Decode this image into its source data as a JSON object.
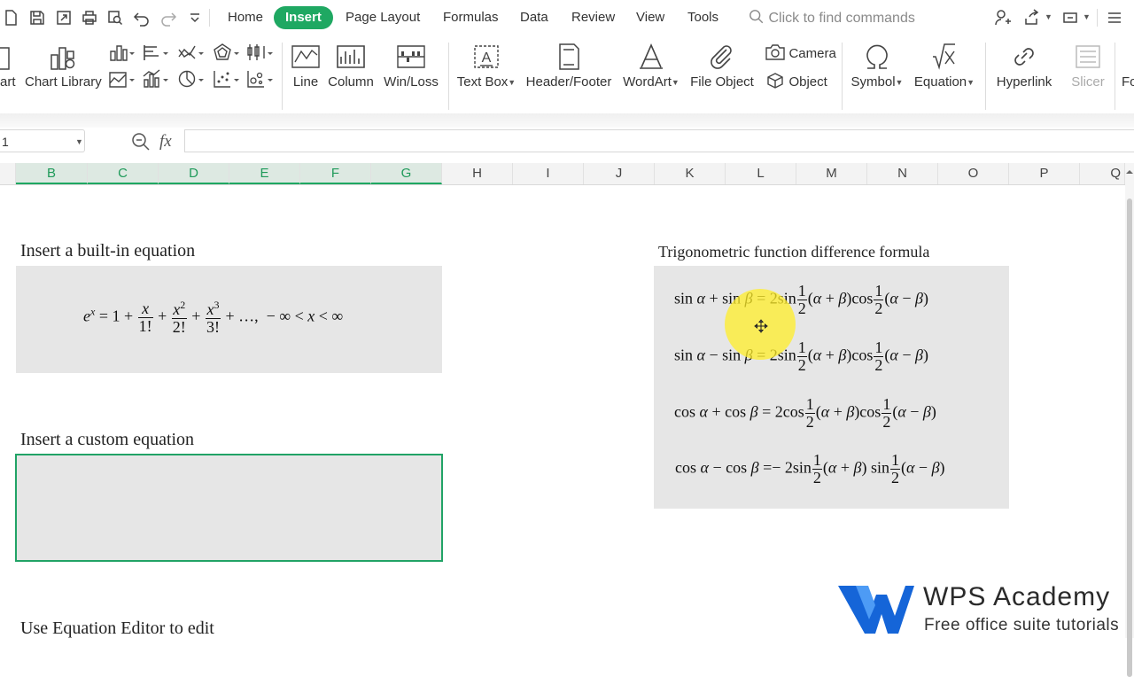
{
  "menu": {
    "items": [
      "Home",
      "Insert",
      "Page Layout",
      "Formulas",
      "Data",
      "Review",
      "View",
      "Tools"
    ],
    "search_placeholder": "Click to find commands"
  },
  "ribbon": {
    "partial_left": "art",
    "chart_library": "Chart Library",
    "line": "Line",
    "column": "Column",
    "winloss": "Win/Loss",
    "text_box": "Text Box",
    "header_footer": "Header/Footer",
    "wordart": "WordArt",
    "file_object": "File Object",
    "camera": "Camera",
    "object": "Object",
    "symbol": "Symbol",
    "equation": "Equation",
    "hyperlink": "Hyperlink",
    "slicer": "Slicer",
    "partial_right": "Fo"
  },
  "formula_bar": {
    "name_box": "1",
    "fx_label": "fx",
    "content": ""
  },
  "columns": [
    "B",
    "C",
    "D",
    "E",
    "F",
    "G",
    "H",
    "I",
    "J",
    "K",
    "L",
    "M",
    "N",
    "O",
    "P",
    "Q"
  ],
  "sheet": {
    "builtin_title": "Insert a built-in equation",
    "custom_title": "Insert a custom equation",
    "editor_title": "Use Equation Editor to edit",
    "trig_title": "Trigonometric function difference formula"
  },
  "watermark": {
    "name": "WPS Academy",
    "tagline": "Free office suite tutorials"
  },
  "colors": {
    "accent": "#1fa862",
    "selection_border": "#21a366",
    "equation_bg": "#e6e6e6",
    "logo_blue": "#1565d8"
  }
}
